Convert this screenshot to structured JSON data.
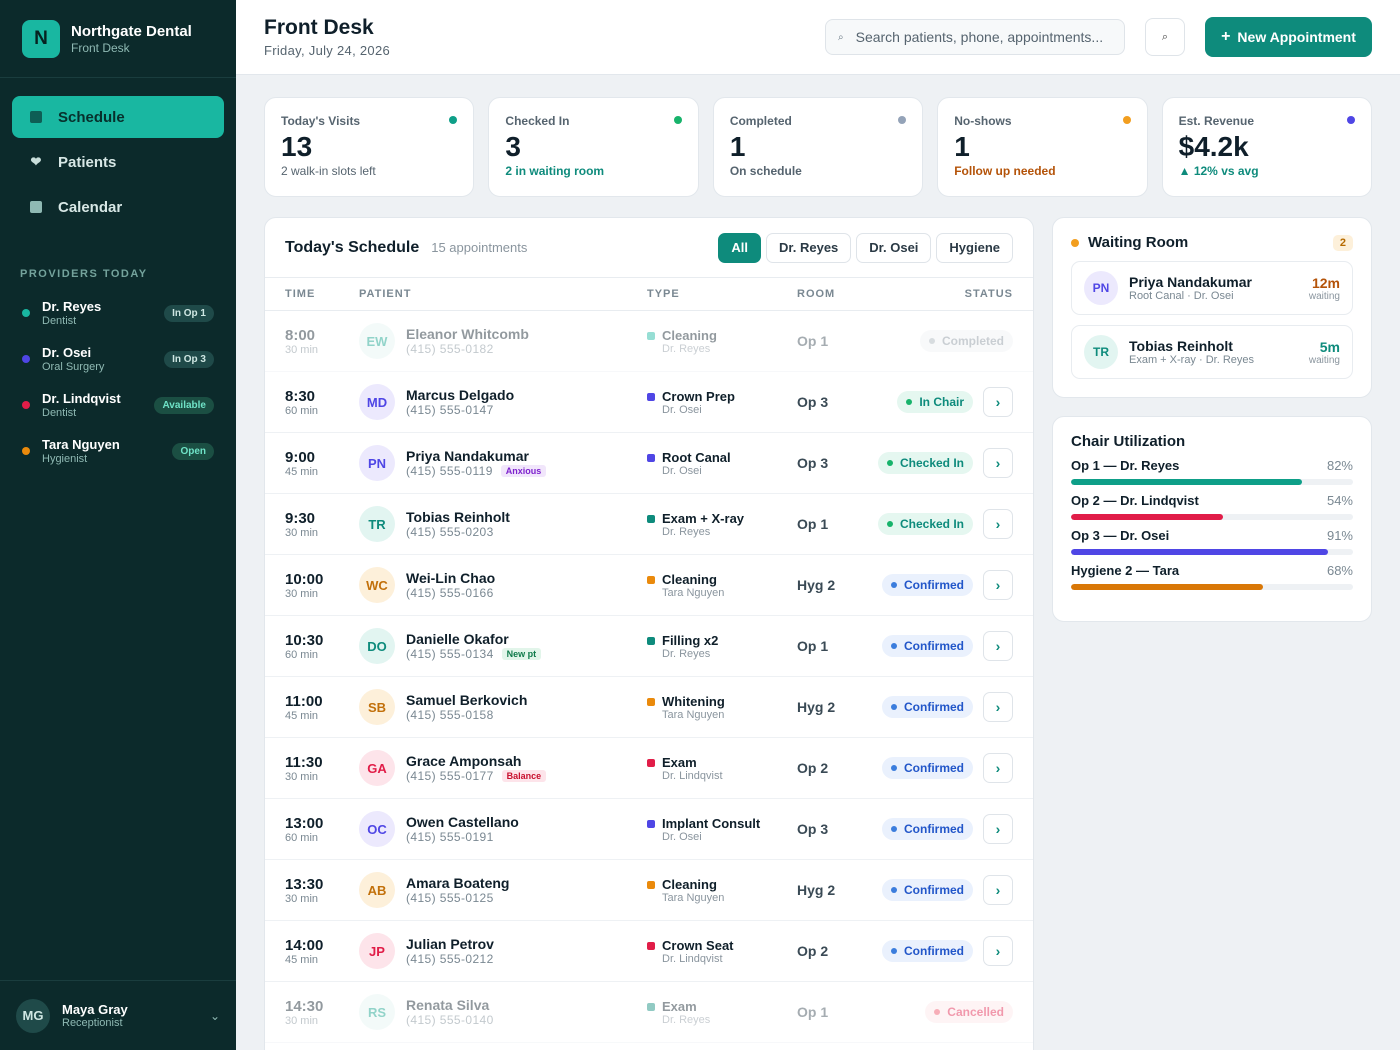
{
  "brand": {
    "logo": "N",
    "name": "Northgate Dental",
    "sub": "Front Desk"
  },
  "nav": [
    {
      "label": "Schedule",
      "icon": "calendar-grid-icon"
    },
    {
      "label": "Patients",
      "icon": "heart-icon"
    },
    {
      "label": "Calendar",
      "icon": "calendar-icon"
    }
  ],
  "providers_title": "PROVIDERS TODAY",
  "providers": [
    {
      "name": "Dr. Reyes",
      "role": "Dentist",
      "badge": "In Op 1",
      "color": "#19b7a1"
    },
    {
      "name": "Dr. Osei",
      "role": "Oral Surgery",
      "badge": "In Op 3",
      "color": "#4f46e5"
    },
    {
      "name": "Dr. Lindqvist",
      "role": "Dentist",
      "badge": "Available",
      "color": "#e11d48"
    },
    {
      "name": "Tara Nguyen",
      "role": "Hygienist",
      "badge": "Open",
      "color": "#ea8a0c"
    }
  ],
  "user": {
    "initials": "MG",
    "name": "Maya Gray",
    "role": "Receptionist"
  },
  "header": {
    "title": "Front Desk",
    "date": "Friday, July 24, 2026",
    "search_placeholder": "Search patients, phone, appointments...",
    "new_label": "New Appointment"
  },
  "stats": [
    {
      "label": "Today's Visits",
      "value": "13",
      "sub": "2 walk-in slots left",
      "color": "#0e9f88"
    },
    {
      "label": "Checked In",
      "value": "3",
      "sub": "2 in waiting room",
      "color": "#17b36b"
    },
    {
      "label": "Completed",
      "value": "1",
      "sub": "On schedule",
      "color": "#94a3b8"
    },
    {
      "label": "No-shows",
      "value": "1",
      "sub": "Follow up needed",
      "color": "#f29e1f"
    },
    {
      "label": "Est. Revenue",
      "value": "$4.2k",
      "sub": "▲ 12% vs avg",
      "color": "#4f46e5"
    }
  ],
  "schedule": {
    "title": "Today's Schedule",
    "count": "15 appointments",
    "filters": [
      "All",
      "Dr. Reyes",
      "Dr. Osei",
      "Hygiene"
    ],
    "columns": {
      "time": "TIME",
      "patient": "PATIENT",
      "type": "TYPE",
      "room": "ROOM",
      "status": "STATUS"
    },
    "rows": [
      {
        "time": "8:00",
        "dur": "30 min",
        "initials": "EW",
        "name": "Eleanor Whitcomb",
        "phone": "(415) 555-0182",
        "tag": "",
        "type": "Cleaning",
        "doc": "Dr. Reyes",
        "room": "Op 1",
        "status": "Completed",
        "kind": "completed",
        "tcolor": "#19b7a1"
      },
      {
        "time": "8:30",
        "dur": "60 min",
        "initials": "MD",
        "name": "Marcus Delgado",
        "phone": "(415) 555-0147",
        "tag": "",
        "type": "Crown Prep",
        "doc": "Dr. Osei",
        "room": "Op 3",
        "status": "In Chair",
        "kind": "inchair",
        "tcolor": "#4f46e5"
      },
      {
        "time": "9:00",
        "dur": "45 min",
        "initials": "PN",
        "name": "Priya Nandakumar",
        "phone": "(415) 555-0119",
        "tag": "Anxious",
        "tagkind": "purple",
        "type": "Root Canal",
        "doc": "Dr. Osei",
        "room": "Op 3",
        "status": "Checked In",
        "kind": "checked",
        "tcolor": "#4f46e5"
      },
      {
        "time": "9:30",
        "dur": "30 min",
        "initials": "TR",
        "name": "Tobias Reinholt",
        "phone": "(415) 555-0203",
        "tag": "",
        "type": "Exam + X-ray",
        "doc": "Dr. Reyes",
        "room": "Op 1",
        "status": "Checked In",
        "kind": "checked",
        "tcolor": "#0e8b7c"
      },
      {
        "time": "10:00",
        "dur": "30 min",
        "initials": "WC",
        "name": "Wei-Lin Chao",
        "phone": "(415) 555-0166",
        "tag": "",
        "type": "Cleaning",
        "doc": "Tara Nguyen",
        "room": "Hyg 2",
        "status": "Confirmed",
        "kind": "confirmed",
        "tcolor": "#ea8a0c"
      },
      {
        "time": "10:30",
        "dur": "60 min",
        "initials": "DO",
        "name": "Danielle Okafor",
        "phone": "(415) 555-0134",
        "tag": "New pt",
        "tagkind": "green",
        "type": "Filling x2",
        "doc": "Dr. Reyes",
        "room": "Op 1",
        "status": "Confirmed",
        "kind": "confirmed",
        "tcolor": "#0e8b7c"
      },
      {
        "time": "11:00",
        "dur": "45 min",
        "initials": "SB",
        "name": "Samuel Berkovich",
        "phone": "(415) 555-0158",
        "tag": "",
        "type": "Whitening",
        "doc": "Tara Nguyen",
        "room": "Hyg 2",
        "status": "Confirmed",
        "kind": "confirmed",
        "tcolor": "#ea8a0c"
      },
      {
        "time": "11:30",
        "dur": "30 min",
        "initials": "GA",
        "name": "Grace Amponsah",
        "phone": "(415) 555-0177",
        "tag": "Balance",
        "tagkind": "red",
        "type": "Exam",
        "doc": "Dr. Lindqvist",
        "room": "Op 2",
        "status": "Confirmed",
        "kind": "confirmed",
        "tcolor": "#e11d48"
      },
      {
        "time": "13:00",
        "dur": "60 min",
        "initials": "OC",
        "name": "Owen Castellano",
        "phone": "(415) 555-0191",
        "tag": "",
        "type": "Implant Consult",
        "doc": "Dr. Osei",
        "room": "Op 3",
        "status": "Confirmed",
        "kind": "confirmed",
        "tcolor": "#4f46e5"
      },
      {
        "time": "13:30",
        "dur": "30 min",
        "initials": "AB",
        "name": "Amara Boateng",
        "phone": "(415) 555-0125",
        "tag": "",
        "type": "Cleaning",
        "doc": "Tara Nguyen",
        "room": "Hyg 2",
        "status": "Confirmed",
        "kind": "confirmed",
        "tcolor": "#ea8a0c"
      },
      {
        "time": "14:00",
        "dur": "45 min",
        "initials": "JP",
        "name": "Julian Petrov",
        "phone": "(415) 555-0212",
        "tag": "",
        "type": "Crown Seat",
        "doc": "Dr. Lindqvist",
        "room": "Op 2",
        "status": "Confirmed",
        "kind": "confirmed",
        "tcolor": "#e11d48"
      },
      {
        "time": "14:30",
        "dur": "30 min",
        "initials": "RS",
        "name": "Renata Silva",
        "phone": "(415) 555-0140",
        "tag": "",
        "type": "Exam",
        "doc": "Dr. Reyes",
        "room": "Op 1",
        "status": "Cancelled",
        "kind": "cancelled",
        "tcolor": "#0e8b7c"
      }
    ]
  },
  "waiting": {
    "title": "Waiting Room",
    "count": "2",
    "items": [
      {
        "initials": "PN",
        "name": "Priya Nandakumar",
        "detail": "Root Canal · Dr. Osei",
        "mins": "12m",
        "label": "waiting",
        "color": "#b45309"
      },
      {
        "initials": "TR",
        "name": "Tobias Reinholt",
        "detail": "Exam + X-ray · Dr. Reyes",
        "mins": "5m",
        "label": "waiting",
        "color": "#0e8b7c"
      }
    ]
  },
  "utilization": {
    "title": "Chair Utilization",
    "items": [
      {
        "label": "Op 1 — Dr. Reyes",
        "pct": "82%",
        "value": 82,
        "color": "#0e9f88"
      },
      {
        "label": "Op 2 — Dr. Lindqvist",
        "pct": "54%",
        "value": 54,
        "color": "#e11d48"
      },
      {
        "label": "Op 3 — Dr. Osei",
        "pct": "91%",
        "value": 91,
        "color": "#4f46e5"
      },
      {
        "label": "Hygiene 2 — Tara",
        "pct": "68%",
        "value": 68,
        "color": "#d97706"
      }
    ]
  }
}
